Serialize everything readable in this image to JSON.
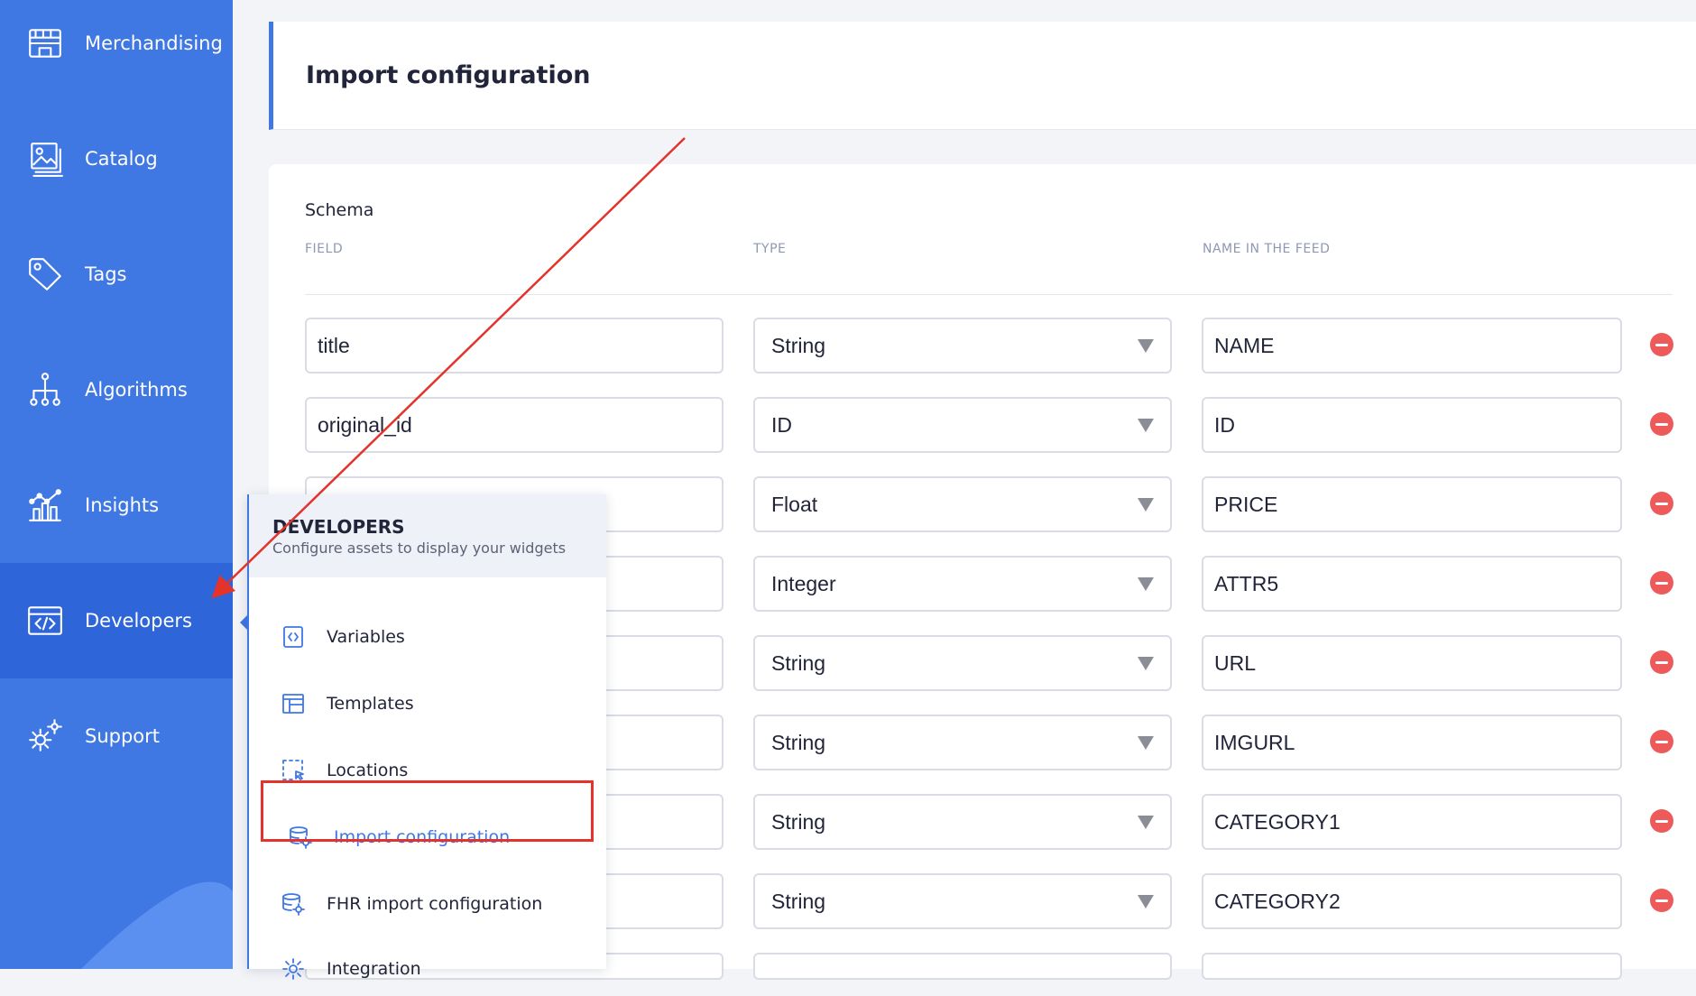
{
  "sidebar": {
    "items": [
      {
        "label": "Merchandising",
        "icon": "storefront-icon"
      },
      {
        "label": "Catalog",
        "icon": "catalog-icon"
      },
      {
        "label": "Tags",
        "icon": "tag-icon"
      },
      {
        "label": "Algorithms",
        "icon": "algorithm-tree-icon"
      },
      {
        "label": "Insights",
        "icon": "chart-icon"
      },
      {
        "label": "Developers",
        "icon": "code-icon",
        "active": true
      },
      {
        "label": "Support",
        "icon": "gears-icon"
      }
    ]
  },
  "header": {
    "title": "Import configuration"
  },
  "schema": {
    "label": "Schema",
    "columns": {
      "field": "FIELD",
      "type": "TYPE",
      "name": "NAME IN THE FEED"
    },
    "rows": [
      {
        "field": "title",
        "type": "String",
        "name": "NAME"
      },
      {
        "field": "original_id",
        "type": "ID",
        "name": "ID"
      },
      {
        "field": "",
        "type": "Float",
        "name": "PRICE"
      },
      {
        "field": "",
        "type": "Integer",
        "name": "ATTR5"
      },
      {
        "field": "",
        "type": "String",
        "name": "URL"
      },
      {
        "field": "",
        "type": "String",
        "name": "IMGURL"
      },
      {
        "field": "",
        "type": "String",
        "name": "CATEGORY1"
      },
      {
        "field": "",
        "type": "String",
        "name": "CATEGORY2"
      }
    ]
  },
  "flyout": {
    "title": "DEVELOPERS",
    "subtitle": "Configure assets to display your widgets",
    "items": [
      {
        "label": "Variables",
        "icon": "variables-icon"
      },
      {
        "label": "Templates",
        "icon": "template-icon"
      },
      {
        "label": "Locations",
        "icon": "location-select-icon"
      },
      {
        "label": "Import configuration",
        "icon": "database-gear-icon",
        "selected": true
      },
      {
        "label": "FHR import configuration",
        "icon": "database-gear-icon"
      },
      {
        "label": "Integration",
        "icon": "gear-icon"
      }
    ]
  },
  "colors": {
    "primary": "#3f77e3",
    "annotation": "#e4332a",
    "remove": "#ee5a5a"
  }
}
